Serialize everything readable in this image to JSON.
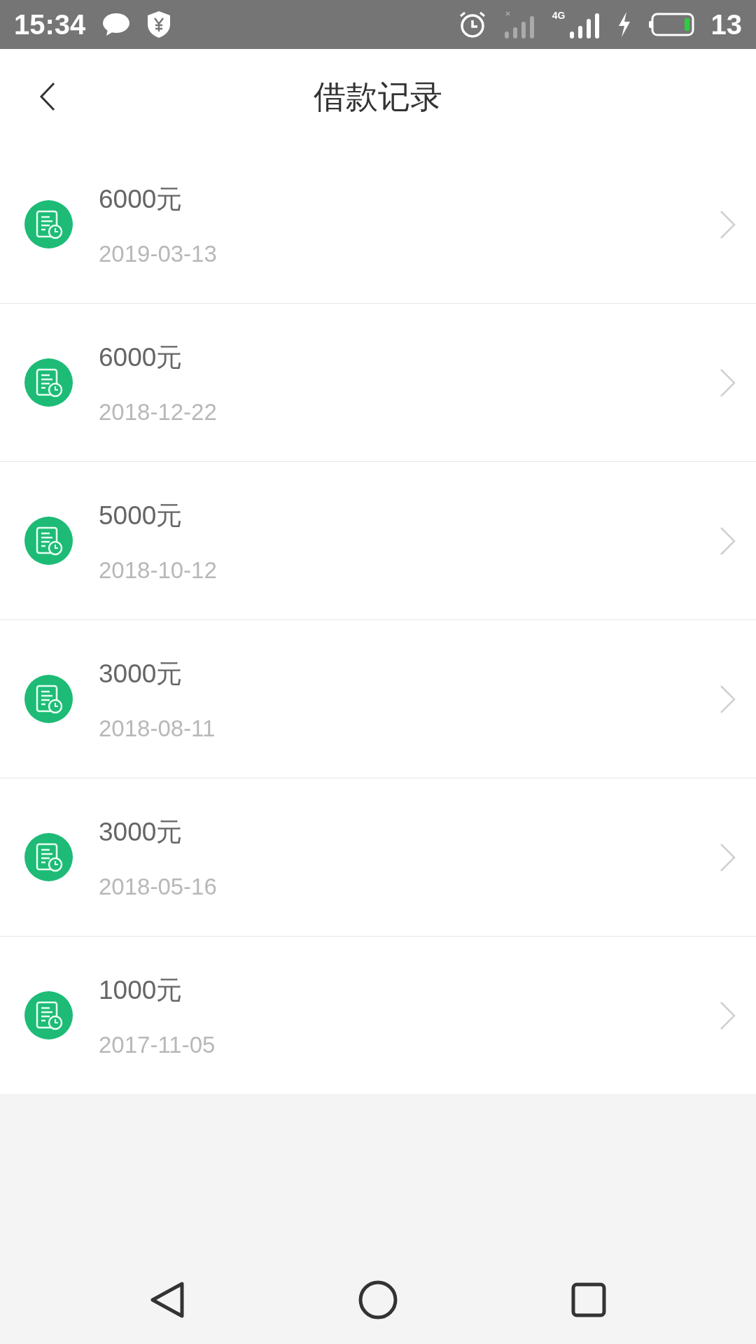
{
  "status_bar": {
    "time": "15:34",
    "network_type": "4G",
    "battery": "13"
  },
  "header": {
    "title": "借款记录"
  },
  "records": [
    {
      "amount": "6000元",
      "date": "2019-03-13"
    },
    {
      "amount": "6000元",
      "date": "2018-12-22"
    },
    {
      "amount": "5000元",
      "date": "2018-10-12"
    },
    {
      "amount": "3000元",
      "date": "2018-08-11"
    },
    {
      "amount": "3000元",
      "date": "2018-05-16"
    },
    {
      "amount": "1000元",
      "date": "2017-11-05"
    }
  ]
}
